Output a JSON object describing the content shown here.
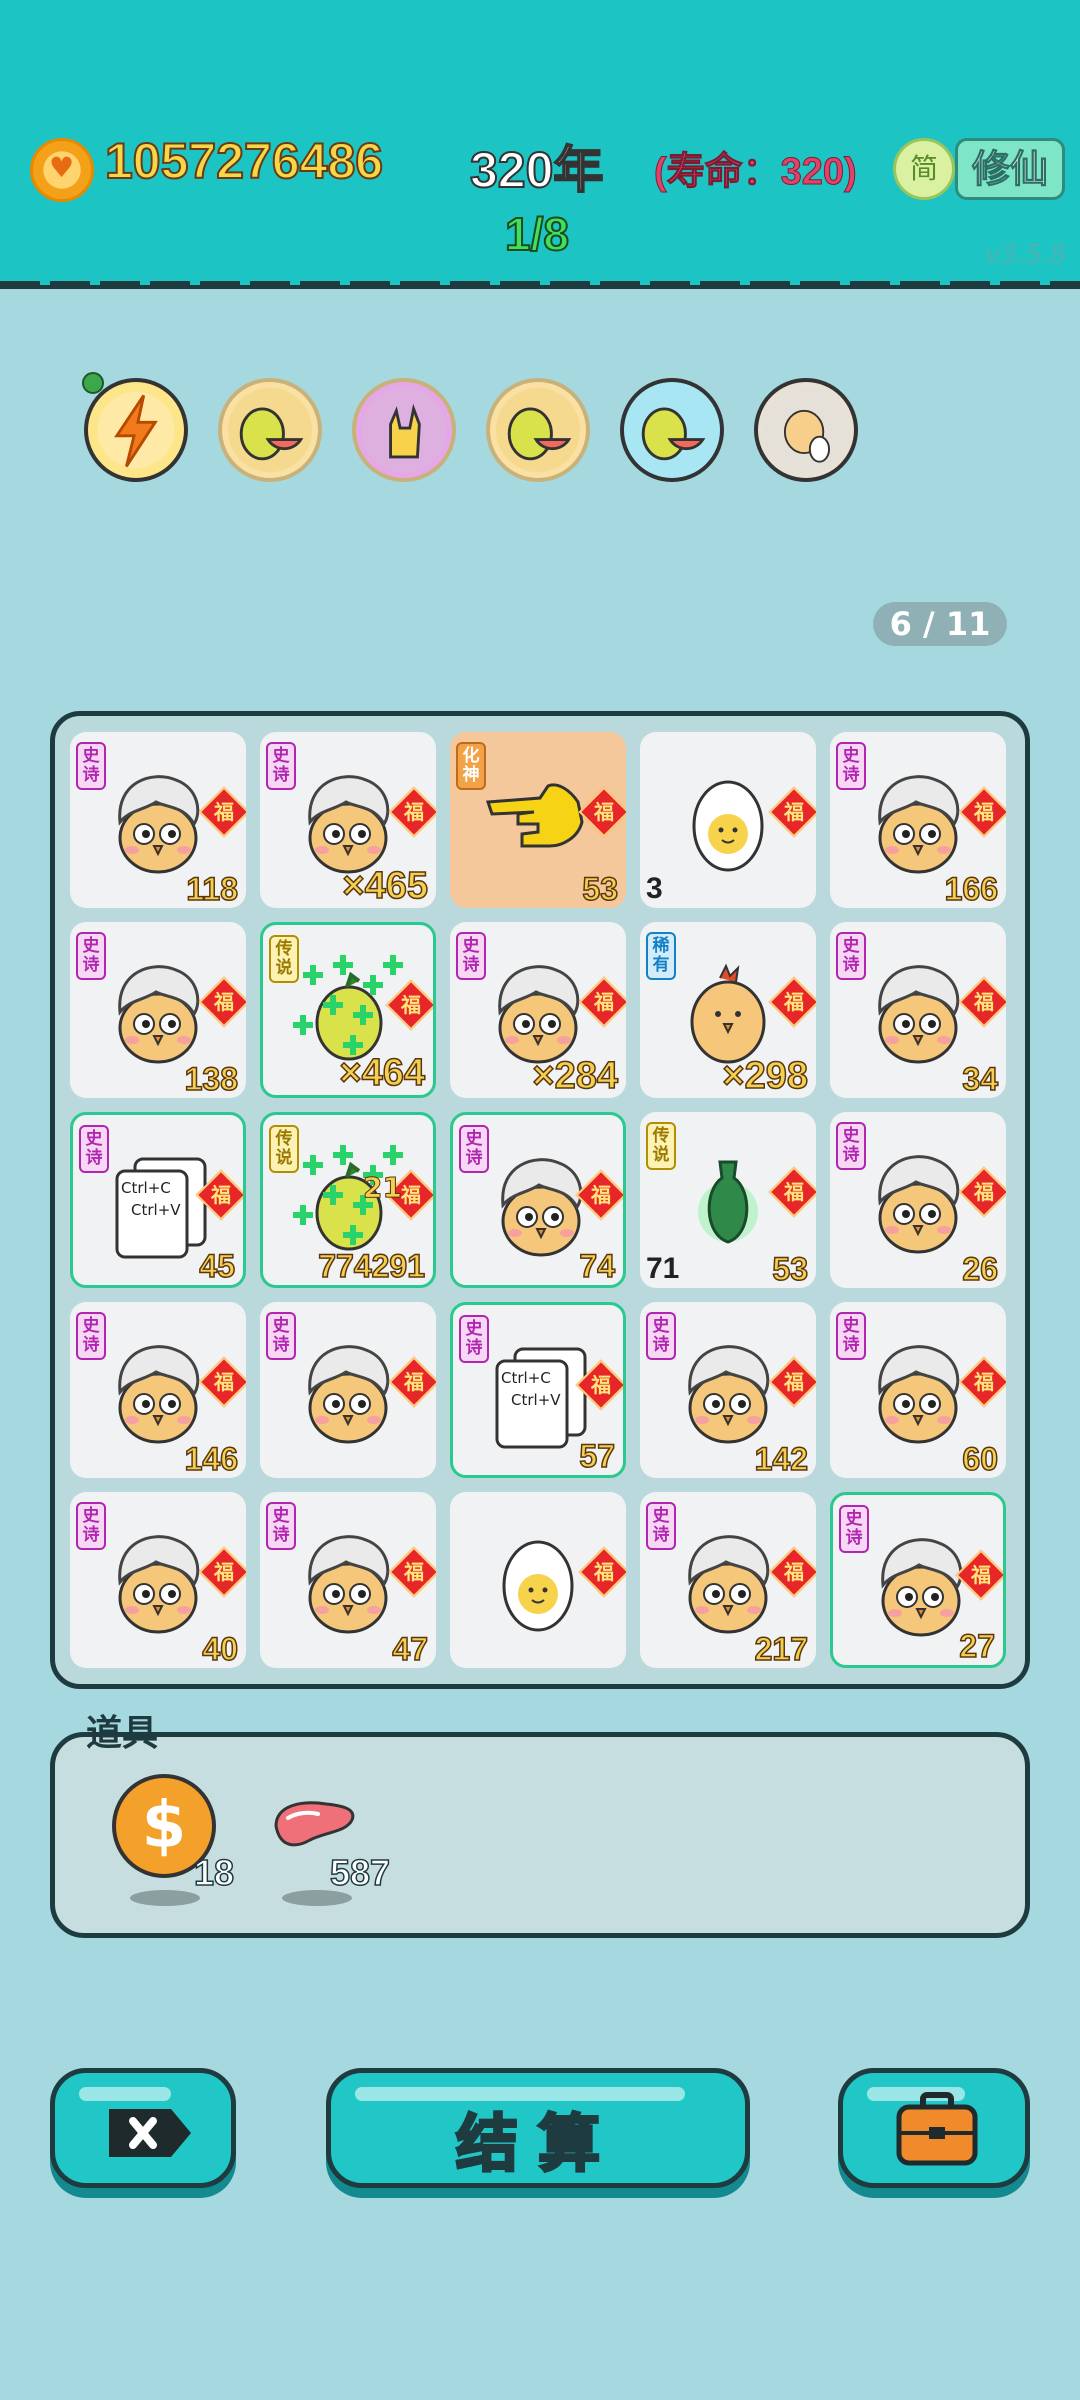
{
  "header": {
    "coins": "1057276486",
    "year": "320年",
    "lifespan": "(寿命：320)",
    "stage": "1/8",
    "lang_button": "简",
    "xiuxian_button": "修仙",
    "version": "v3.5.8"
  },
  "relics": [
    "lightning-relic-icon",
    "pomelo-relic-icon",
    "rock-hand-relic-icon",
    "pomelo-relic-icon",
    "pomelo-relic-icon",
    "chick-egg-relic-icon"
  ],
  "page_indicator": "6 / 11",
  "grid": {
    "cells": [
      {
        "tag": "史诗",
        "num": "118"
      },
      {
        "tag": "史诗",
        "mult": "×465"
      },
      {
        "tag": "化神",
        "num": "53"
      },
      {
        "left": "3"
      },
      {
        "tag": "史诗",
        "num": "166"
      },
      {
        "tag": "史诗",
        "num": "138"
      },
      {
        "tag": "传说",
        "mult": "×464"
      },
      {
        "tag": "史诗",
        "mult": "×284"
      },
      {
        "tag": "稀有",
        "mult": "×298"
      },
      {
        "tag": "史诗",
        "num": "34"
      },
      {
        "tag": "史诗",
        "num": "45",
        "card_line1": "Ctrl+C",
        "card_line2": "Ctrl+V"
      },
      {
        "tag": "传说",
        "num": "774291",
        "badge": "21"
      },
      {
        "tag": "史诗",
        "num": "74"
      },
      {
        "tag": "传说",
        "left": "71",
        "num": "53"
      },
      {
        "tag": "史诗",
        "num": "26"
      },
      {
        "tag": "史诗",
        "num": "146"
      },
      {
        "tag": "史诗"
      },
      {
        "tag": "史诗",
        "num": "57",
        "card_line1": "Ctrl+C",
        "card_line2": "Ctrl+V"
      },
      {
        "tag": "史诗",
        "num": "142"
      },
      {
        "tag": "史诗",
        "num": "60"
      },
      {
        "tag": "史诗",
        "num": "40"
      },
      {
        "tag": "史诗",
        "num": "47"
      },
      {},
      {
        "tag": "史诗",
        "num": "217"
      },
      {
        "tag": "史诗",
        "num": "27"
      }
    ],
    "fu_label": "福"
  },
  "props": {
    "title": "道具",
    "coin_symbol": "$",
    "coin_count": "18",
    "liver_count": "587"
  },
  "buttons": {
    "settle": "结算",
    "close_icon": "close-x-icon",
    "bag_icon": "briefcase-icon"
  },
  "colors": {
    "header_bg": "#1cc4c4",
    "page_bg": "#a6d8df",
    "epic_tag": "#b125b0",
    "legend_tag": "#b09000",
    "rare_tag": "#1680c4",
    "number_gold": "#f3d050",
    "highlight_border": "#2ac98e"
  }
}
